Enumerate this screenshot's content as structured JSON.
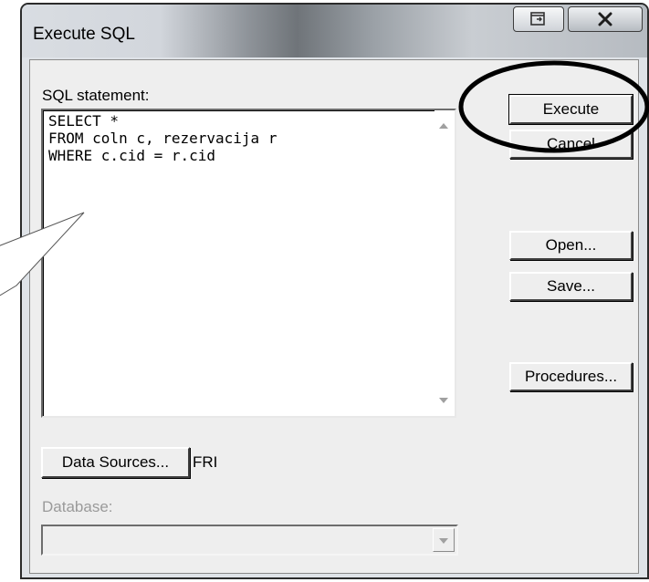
{
  "window": {
    "title": "Execute SQL"
  },
  "sql": {
    "label": "SQL statement:",
    "text": "SELECT *\nFROM coln c, rezervacija r\nWHERE c.cid = r.cid"
  },
  "buttons": {
    "execute": "Execute",
    "cancel": "Cancel",
    "open": "Open...",
    "save": "Save...",
    "procedures": "Procedures...",
    "data_sources": "Data Sources..."
  },
  "data_source": {
    "value": "FRI"
  },
  "database": {
    "label": "Database:",
    "value": ""
  },
  "icons": {
    "restore": "restore-icon",
    "close": "close-icon",
    "scroll_up": "scroll-up-arrow-icon",
    "scroll_down": "scroll-down-arrow-icon",
    "combo_dropdown": "chevron-down-icon"
  },
  "colors": {
    "dialog_background": "#eeeeee",
    "titlebar_dark": "#6f7479",
    "annotation_ellipse": "#000000"
  }
}
